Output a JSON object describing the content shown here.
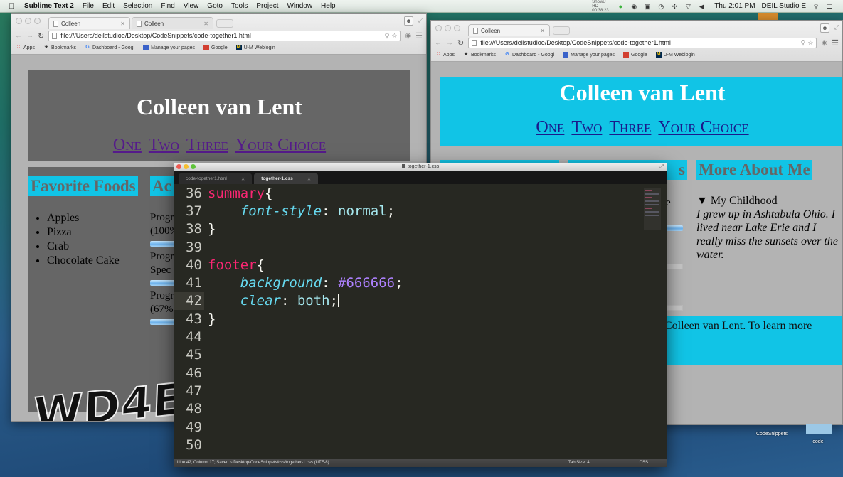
{
  "menubar": {
    "apple_icon": "apple-logo-icon",
    "app_name": "Sublime Text 2",
    "menus": [
      "File",
      "Edit",
      "Selection",
      "Find",
      "View",
      "Goto",
      "Tools",
      "Project",
      "Window",
      "Help"
    ],
    "showu": "ShowU HD 00:38:23",
    "status_icons": [
      "record-icon",
      "bubble-icon",
      "airplay-icon",
      "time-machine-icon",
      "bluetooth-icon",
      "wifi-icon",
      "volume-icon"
    ],
    "clock": "Thu 2:01 PM",
    "user": "DEIL Studio E",
    "spotlight_icon": "search-icon",
    "notifications_icon": "list-icon"
  },
  "left_browser": {
    "tabs": [
      {
        "label": "Colleen"
      },
      {
        "label": "Colleen"
      }
    ],
    "url": "file:///Users/deilstudioe/Desktop/CodeSnippets/code-together1.html",
    "bookmarks": [
      {
        "label": "Apps"
      },
      {
        "label": "Bookmarks"
      },
      {
        "label": "Dashboard - Googl"
      },
      {
        "label": "Manage your pages"
      },
      {
        "label": "Google"
      },
      {
        "label": "U-M Weblogin"
      }
    ],
    "page": {
      "title": "Colleen van Lent",
      "nav": [
        "One",
        "Two",
        "Three",
        "Your Choice"
      ],
      "sections": [
        "Favorite Foods",
        "Ac"
      ],
      "foods": [
        "Apples",
        "Pizza",
        "Crab",
        "Chocolate Cake"
      ],
      "progress_lines": [
        [
          "Progr",
          "(100%"
        ],
        [
          "Progr",
          "Spec"
        ],
        [
          "Progr",
          "(67%"
        ]
      ],
      "logo": "WD4E",
      "footer": "van Lent. To learn more about"
    }
  },
  "right_browser": {
    "tabs": [
      {
        "label": "Colleen"
      }
    ],
    "url": "file:///Users/deilstudioe/Desktop/CodeSnippets/code-together1.html",
    "bookmarks": [
      {
        "label": "Apps"
      },
      {
        "label": "Bookmarks"
      },
      {
        "label": "Dashboard - Googl"
      },
      {
        "label": "Manage your pages"
      },
      {
        "label": "Google"
      },
      {
        "label": "U-M Weblogin"
      }
    ],
    "page": {
      "title": "Colleen van Lent",
      "nav": [
        "One",
        "Two",
        "Three",
        "Your Choice"
      ],
      "sections": [
        "",
        "s",
        "More About Me"
      ],
      "summary": "▼ My Childhood",
      "story": "I grew up in Ashtabula Ohio. I lived near Lake Erie and I really miss the sunsets over the water.",
      "partial_text": "e",
      "footer": "Colleen van Lent. To learn more"
    }
  },
  "editor": {
    "window_title": "together-1.css",
    "tabs": [
      {
        "label": "code-together1.html",
        "active": false
      },
      {
        "label": "together-1.css",
        "active": true
      }
    ],
    "lines": [
      {
        "n": "36",
        "tokens": [
          [
            "sel",
            "summary"
          ],
          [
            "punc",
            "{"
          ]
        ]
      },
      {
        "n": "37",
        "tokens": [
          [
            "punc",
            "    "
          ],
          [
            "prop",
            "font-style"
          ],
          [
            "punc",
            ": "
          ],
          [
            "val",
            "normal"
          ],
          [
            "punc",
            ";"
          ]
        ]
      },
      {
        "n": "38",
        "tokens": [
          [
            "punc",
            "}"
          ]
        ]
      },
      {
        "n": "39",
        "tokens": []
      },
      {
        "n": "40",
        "tokens": [
          [
            "sel",
            "footer"
          ],
          [
            "punc",
            "{"
          ]
        ]
      },
      {
        "n": "41",
        "tokens": [
          [
            "punc",
            "    "
          ],
          [
            "prop",
            "background"
          ],
          [
            "punc",
            ": "
          ],
          [
            "num",
            "#666666"
          ],
          [
            "punc",
            ";"
          ]
        ]
      },
      {
        "n": "42",
        "tokens": [
          [
            "punc",
            "    "
          ],
          [
            "prop",
            "clear"
          ],
          [
            "punc",
            ": "
          ],
          [
            "val",
            "both"
          ],
          [
            "punc",
            ";"
          ]
        ],
        "current": true
      },
      {
        "n": "43",
        "tokens": [
          [
            "punc",
            "}"
          ]
        ]
      },
      {
        "n": "44",
        "tokens": []
      },
      {
        "n": "45",
        "tokens": []
      },
      {
        "n": "46",
        "tokens": []
      },
      {
        "n": "47",
        "tokens": []
      },
      {
        "n": "48",
        "tokens": []
      },
      {
        "n": "49",
        "tokens": []
      },
      {
        "n": "50",
        "tokens": []
      }
    ],
    "status": "Line 42, Column 17; Saved ~/Desktop/CodeSnippets/css/together-1.css (UTF-8)",
    "tab_size": "Tab Size: 4",
    "syntax": "CSS"
  },
  "desktop": {
    "items": [
      "CodeSnippets",
      "code"
    ]
  },
  "colors": {
    "header_gray": "#666666",
    "cyan": "#11c4e6",
    "editor_bg": "#272822",
    "keyword_pink": "#f92672",
    "property_cyan": "#66d9ef",
    "number_purple": "#ae81ff"
  }
}
